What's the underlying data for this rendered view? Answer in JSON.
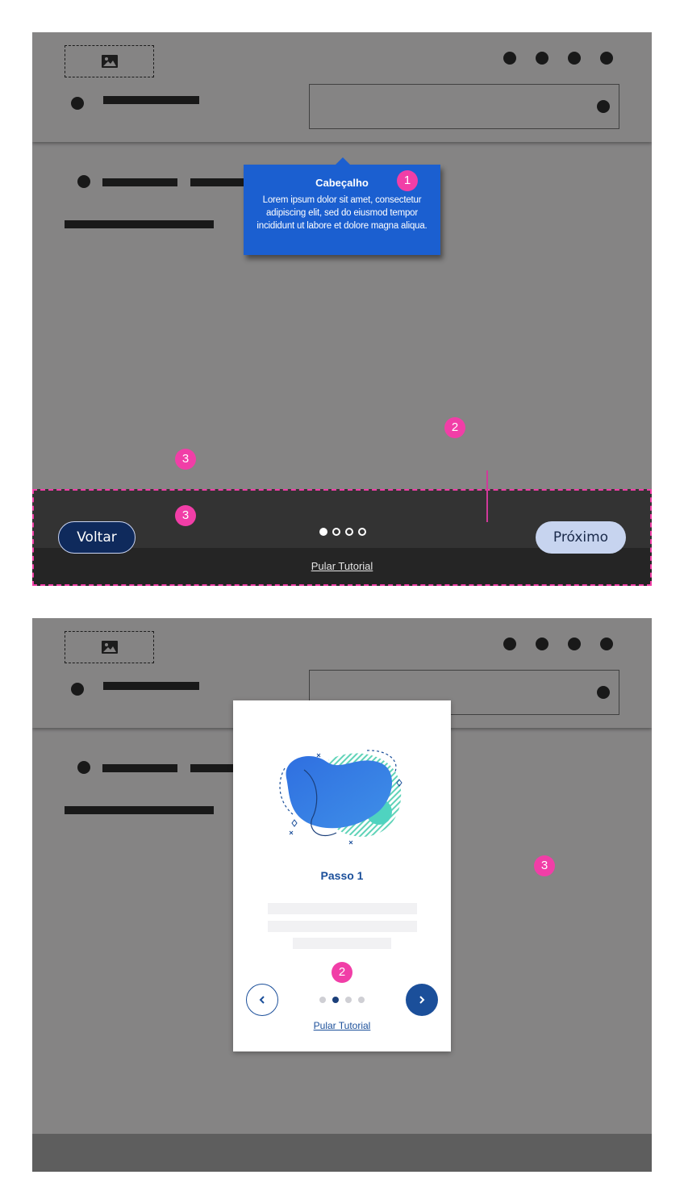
{
  "screen1": {
    "tooltip": {
      "title": "Cabeçalho",
      "body": "Lorem ipsum dolor sit amet, consectetur adipiscing elit, sed do eiusmod tempor incididunt ut labore et dolore magna aliqua."
    },
    "badges": [
      "1",
      "2",
      "3",
      "3"
    ],
    "tour_bar": {
      "back_label": "Voltar",
      "next_label": "Próximo",
      "skip_label": "Pular Tutorial",
      "progress": {
        "total": 4,
        "current": 1
      }
    }
  },
  "screen2": {
    "modal": {
      "step_title": "Passo 1",
      "skip_label": "Pular Tutorial",
      "progress": {
        "total": 4,
        "current": 2
      }
    },
    "badges": [
      "3",
      "2"
    ]
  },
  "icons": {
    "image": "image-placeholder-icon",
    "prev": "chevron-left-icon",
    "next": "chevron-right-icon"
  },
  "colors": {
    "tooltip": "#1b5fd0",
    "badge": "#f13ea7",
    "primary": "#1b4f9a",
    "back_button": "#0f2a5c",
    "next_button": "#c7d4ef"
  }
}
